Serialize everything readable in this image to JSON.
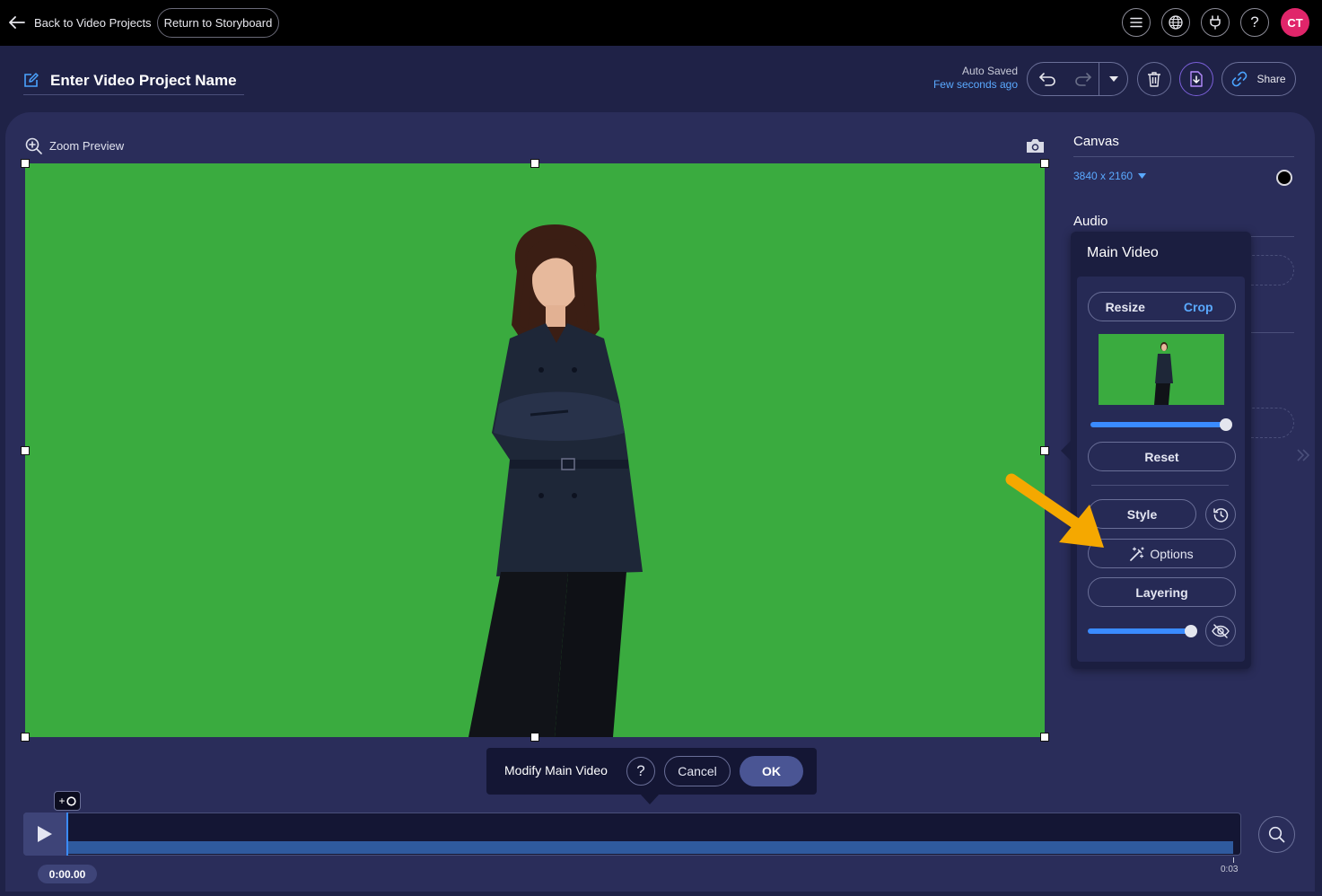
{
  "topbar": {
    "back_label": "Back to Video Projects",
    "storyboard_label": "Return to Storyboard",
    "avatar_initials": "CT"
  },
  "project": {
    "name": "Enter Video Project Name",
    "autosave_status": "Auto Saved",
    "autosave_time": "Few seconds ago",
    "share_label": "Share"
  },
  "preview": {
    "zoom_label": "Zoom Preview"
  },
  "right_panel": {
    "canvas_title": "Canvas",
    "canvas_size": "3840 x 2160",
    "canvas_color": "#000000",
    "audio_title": "Audio"
  },
  "popup": {
    "title": "Main Video",
    "resize_label": "Resize",
    "crop_label": "Crop",
    "reset_label": "Reset",
    "style_label": "Style",
    "options_label": "Options",
    "layering_label": "Layering",
    "scale_slider_value": 1.0,
    "opacity_slider_value": 1.0
  },
  "modify_bar": {
    "label": "Modify Main Video",
    "cancel_label": "Cancel",
    "ok_label": "OK"
  },
  "timeline": {
    "current_time": "0:00.00",
    "end_time": "0:03"
  },
  "colors": {
    "accent": "#5aa9ff",
    "chroma_green": "#3aab3f",
    "avatar": "#e0256a",
    "annotation_arrow": "#f5a800"
  }
}
